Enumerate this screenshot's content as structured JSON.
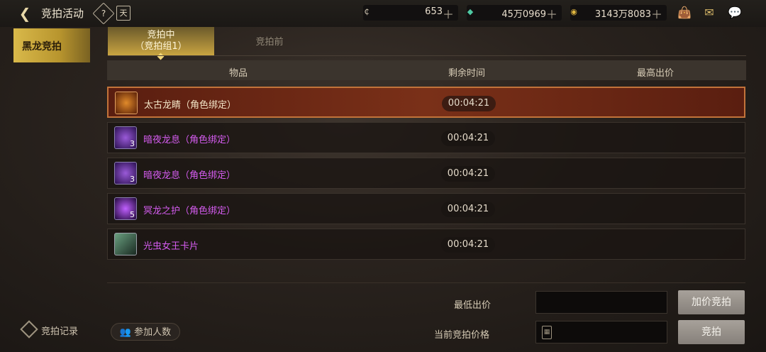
{
  "header": {
    "title": "竞拍活动",
    "help_icon": "?",
    "calendar_icon": "天",
    "currencies": [
      {
        "icon": "c-coin-icon",
        "symbol": "₵",
        "value": "653",
        "color": "#c9bfae"
      },
      {
        "icon": "gem-icon",
        "symbol": "◆",
        "value": "45万0969",
        "color": "#4fc9a3"
      },
      {
        "icon": "gold-coin-icon",
        "symbol": "◉",
        "value": "3143万8083",
        "color": "#e0b640"
      }
    ]
  },
  "sidebar": {
    "items": [
      {
        "label": "黑龙竞拍",
        "active": true
      }
    ],
    "record_label": "竞拍记录"
  },
  "tabs": [
    {
      "label_line1": "竞拍中",
      "label_line2": "（竞拍组1）",
      "active": true
    },
    {
      "label": "竞拍前",
      "active": false
    }
  ],
  "table": {
    "headers": [
      "物品",
      "剩余时间",
      "最高出价"
    ],
    "rows": [
      {
        "name": "太古龙睛（角色绑定）",
        "time": "00:04:21",
        "count": "",
        "color": "#f3e6c8",
        "icon_color": "#c05a1a",
        "selected": true
      },
      {
        "name": "暗夜龙息（角色绑定）",
        "time": "00:04:21",
        "count": "3",
        "color": "#d55cf0",
        "icon_color": "#6a3ab0",
        "selected": false
      },
      {
        "name": "暗夜龙息（角色绑定）",
        "time": "00:04:21",
        "count": "3",
        "color": "#d55cf0",
        "icon_color": "#6a3ab0",
        "selected": false
      },
      {
        "name": "冥龙之护（角色绑定）",
        "time": "00:04:21",
        "count": "5",
        "color": "#d55cf0",
        "icon_color": "#7a2ac8",
        "selected": false
      },
      {
        "name": "光虫女王卡片",
        "time": "00:04:21",
        "count": "",
        "color": "#d55cf0",
        "icon_color": "#3a6a4a",
        "selected": false
      }
    ]
  },
  "bid": {
    "min_label": "最低出价",
    "current_label": "当前竞拍价格",
    "raise_button": "加价竞拍",
    "bid_button": "竞拍",
    "participants_label": "参加人数"
  }
}
